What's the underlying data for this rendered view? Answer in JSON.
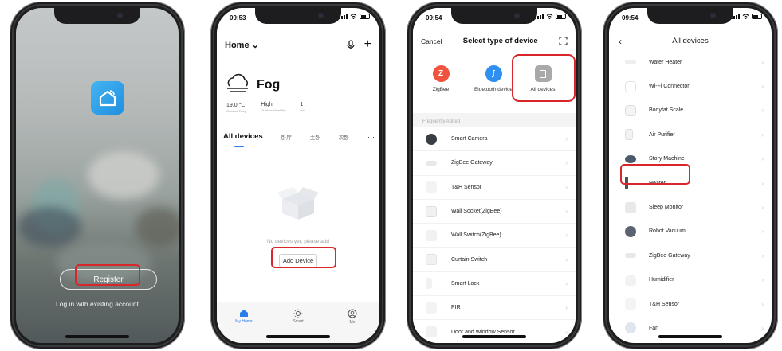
{
  "phone1": {
    "register_label": "Register",
    "login_label": "Log in with existing account",
    "app_icon": "smart-home-icon"
  },
  "phone2": {
    "time": "09:53",
    "home_label": "Home",
    "weather": {
      "condition": "Fog",
      "temp_value": "19.0 ℃",
      "temp_label": "Outdoor Temp",
      "humidity_value": "High",
      "humidity_label": "Outdoor Humidity",
      "third_value": "1",
      "third_label": "uvi"
    },
    "tabs": [
      "All devices",
      "卧厅",
      "主卧",
      "次卧",
      "···"
    ],
    "empty_text": "No devices yet, please add",
    "add_device_label": "Add Device",
    "nav": [
      "My Home",
      "Smart",
      "Me"
    ]
  },
  "phone3": {
    "time": "09:54",
    "cancel_label": "Cancel",
    "title": "Select type of device",
    "categories": [
      {
        "label": "ZigBee",
        "color": "#f0533e"
      },
      {
        "label": "Bluetooth device",
        "color": "#2f8ff0"
      },
      {
        "label": "All devices",
        "color": "#a9a9a9"
      }
    ],
    "frequent_label": "Frequently Added",
    "items": [
      "Smart Camera",
      "ZigBee Gateway",
      "T&H Sensor",
      "Wall Socket(ZigBee)",
      "Wall Switch(ZigBee)",
      "Curtain Switch",
      "Smart Lock",
      "PIR",
      "Door and Window Sensor"
    ]
  },
  "phone4": {
    "time": "09:54",
    "title": "All devices",
    "items": [
      "Water Heater",
      "Wi-Fi Connector",
      "Bodyfat Scale",
      "Air Purifier",
      "Story Machine",
      "Heater",
      "Sleep Monitor",
      "Robot Vacuum",
      "ZigBee Gateway",
      "Humidifier",
      "T&H Sensor",
      "Fan"
    ]
  },
  "colors": {
    "accent": "#2a7ee8",
    "highlight": "#d9262a"
  }
}
